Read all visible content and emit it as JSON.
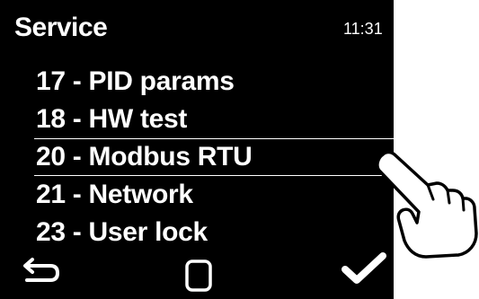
{
  "header": {
    "title": "Service",
    "time": "11:31"
  },
  "menu": {
    "items": [
      {
        "label": "17 - PID params",
        "selected": false
      },
      {
        "label": "18 - HW test",
        "selected": false
      },
      {
        "label": "20 - Modbus RTU",
        "selected": true
      },
      {
        "label": "21 - Network",
        "selected": false
      },
      {
        "label": "23 - User lock",
        "selected": false
      }
    ]
  },
  "toolbar": {
    "back_icon": "back-arrow-icon",
    "home_icon": "square-icon",
    "confirm_icon": "checkmark-icon"
  },
  "overlay": {
    "pointer_icon": "hand-pointer-icon"
  },
  "colors": {
    "screen_background": "#000000",
    "foreground": "#ffffff",
    "page_background": "#ffffff"
  }
}
